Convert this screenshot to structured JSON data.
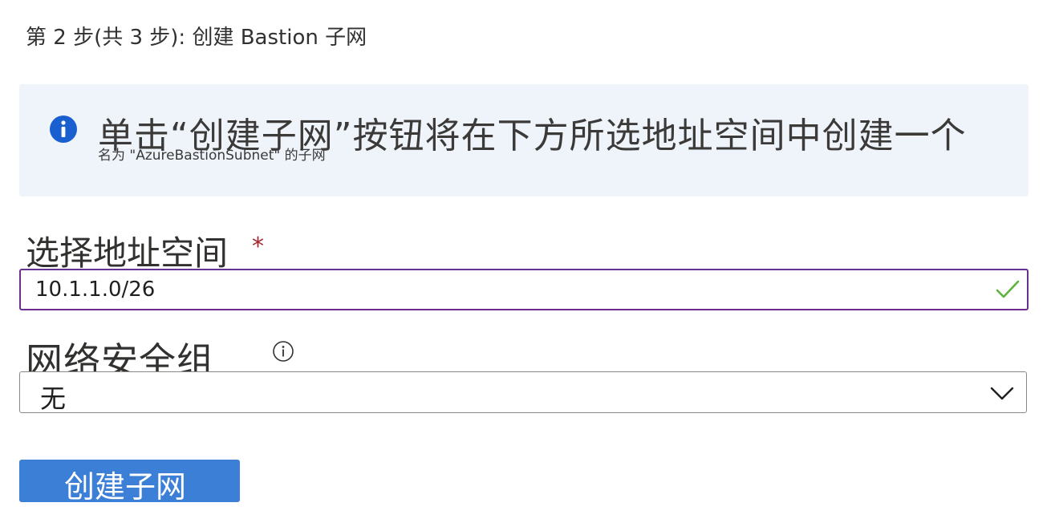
{
  "step": {
    "title": "第 2 步(共 3 步): 创建 Bastion 子网"
  },
  "info": {
    "icon": "info-icon",
    "main_text": "单击“创建子网”按钮将在下方所选地址空间中创建一个",
    "sub_text": "名为 \"AzureBastionSubnet\" 的子网",
    "background_color": "#eff4fb",
    "icon_color": "#1a5fd0"
  },
  "address_space": {
    "label": "选择地址空间",
    "required_marker": "*",
    "value": "10.1.1.0/26",
    "status_icon": "checkmark-icon",
    "border_color": "#6b2f8e",
    "check_color": "#5db33b"
  },
  "nsg": {
    "label": "网络安全组",
    "info_icon": "info-circle-icon",
    "selected_value": "无",
    "dropdown_icon": "chevron-down-icon"
  },
  "actions": {
    "create_subnet_label": "创建子网",
    "button_color": "#3b7fd6"
  }
}
